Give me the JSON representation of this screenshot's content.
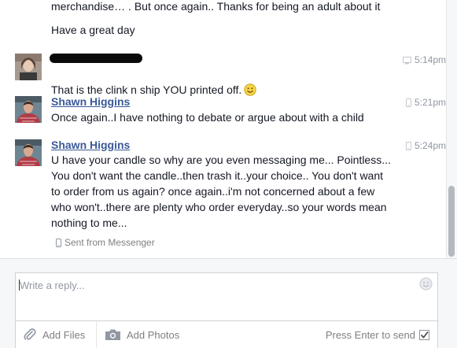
{
  "thread": {
    "previous_lines": [
      "merchandise… . But once again.. Thanks for being an adult about it",
      "Have a great day"
    ],
    "messages": [
      {
        "sender": "",
        "time": "5:14pm",
        "device": "desktop",
        "text": "That is the clink n ship YOU printed off."
      },
      {
        "sender": "Shawn Higgins",
        "time": "5:21pm",
        "device": "mobile",
        "text": "Once again..I have nothing to debate or argue about with a child"
      },
      {
        "sender": "Shawn Higgins",
        "time": "5:24pm",
        "device": "mobile",
        "text": "U have your candle so why are you even messaging me... Pointless...\nYou don't want the candle..then trash it..your choice.. You don't want\nto order from us again?  once again..i'm not concerned about a few\nwho won't..there are plenty who order everyday..so your words mean\nnothing to me..."
      }
    ],
    "sent_from": "Sent from Messenger"
  },
  "composer": {
    "placeholder": "Write a reply...",
    "value": "",
    "add_files_label": "Add Files",
    "add_photos_label": "Add Photos",
    "press_enter_label": "Press Enter to send",
    "press_enter_checked": true
  },
  "colors": {
    "sender_link": "#3b5998",
    "timestamp": "#9197a3",
    "text": "#141823"
  },
  "icons": [
    "desktop-icon",
    "mobile-icon",
    "smiley-emoji-icon",
    "emoji-picker-icon",
    "paperclip-icon",
    "camera-icon",
    "checkbox-icon"
  ]
}
